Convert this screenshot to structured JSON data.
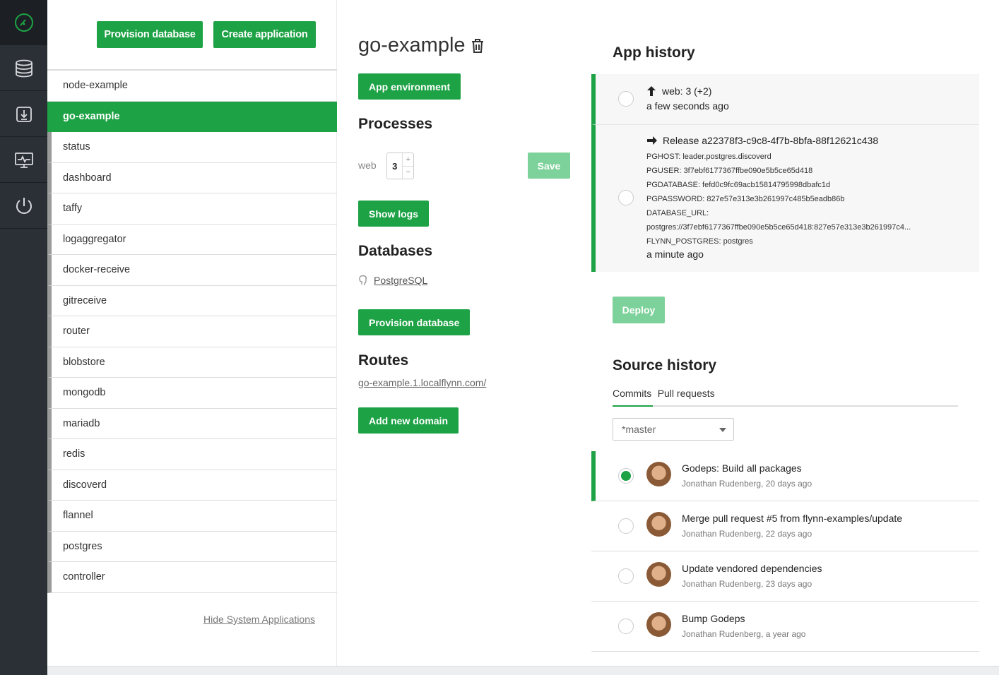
{
  "rail": {
    "items": [
      {
        "icon": "dashboard-gauge-icon",
        "active": true
      },
      {
        "icon": "database-icon",
        "active": false
      },
      {
        "icon": "download-icon",
        "active": false
      },
      {
        "icon": "monitor-icon",
        "active": false
      },
      {
        "icon": "power-icon",
        "active": false
      }
    ]
  },
  "apps": {
    "provision_db_label": "Provision database",
    "create_app_label": "Create application",
    "items": [
      {
        "name": "node-example",
        "system": false,
        "active": false
      },
      {
        "name": "go-example",
        "system": false,
        "active": true
      },
      {
        "name": "status",
        "system": true
      },
      {
        "name": "dashboard",
        "system": true
      },
      {
        "name": "taffy",
        "system": true
      },
      {
        "name": "logaggregator",
        "system": true
      },
      {
        "name": "docker-receive",
        "system": true
      },
      {
        "name": "gitreceive",
        "system": true
      },
      {
        "name": "router",
        "system": true
      },
      {
        "name": "blobstore",
        "system": true
      },
      {
        "name": "mongodb",
        "system": true
      },
      {
        "name": "mariadb",
        "system": true
      },
      {
        "name": "redis",
        "system": true
      },
      {
        "name": "discoverd",
        "system": true
      },
      {
        "name": "flannel",
        "system": true
      },
      {
        "name": "postgres",
        "system": true
      },
      {
        "name": "controller",
        "system": true
      }
    ],
    "hide_system_label": "Hide System Applications"
  },
  "detail": {
    "title": "go-example",
    "app_env_label": "App environment",
    "processes_heading": "Processes",
    "process_type": "web",
    "process_count": "3",
    "save_label": "Save",
    "show_logs_label": "Show logs",
    "databases_heading": "Databases",
    "db_link": "PostgreSQL",
    "provision_db_label": "Provision database",
    "routes_heading": "Routes",
    "route_link": "go-example.1.localflynn.com/",
    "add_domain_label": "Add new domain"
  },
  "history": {
    "heading": "App history",
    "events": [
      {
        "title": "web: 3 (+2)",
        "ago": "a few seconds ago"
      },
      {
        "title": "Release a22378f3-c9c8-4f7b-8bfa-88f12621c438",
        "env": [
          "PGHOST: leader.postgres.discoverd",
          "PGUSER: 3f7ebf6177367ffbe090e5b5ce65d418",
          "PGDATABASE: fefd0c9fc69acb15814795998dbafc1d",
          "PGPASSWORD: 827e57e313e3b261997c485b5eadb86b",
          "DATABASE_URL:",
          "postgres://3f7ebf6177367ffbe090e5b5ce65d418:827e57e313e3b261997c4...",
          "FLYNN_POSTGRES: postgres"
        ],
        "ago": "a minute ago"
      }
    ],
    "deploy_label": "Deploy"
  },
  "source": {
    "heading": "Source history",
    "tabs": [
      "Commits",
      "Pull requests"
    ],
    "branch": "*master",
    "commits": [
      {
        "message": "Godeps: Build all packages",
        "meta": "Jonathan Rudenberg, 20 days ago",
        "selected": true
      },
      {
        "message": "Merge pull request #5 from flynn-examples/update",
        "meta": "Jonathan Rudenberg, 22 days ago",
        "selected": false
      },
      {
        "message": "Update vendored dependencies",
        "meta": "Jonathan Rudenberg, 23 days ago",
        "selected": false
      },
      {
        "message": "Bump Godeps",
        "meta": "Jonathan Rudenberg, a year ago",
        "selected": false
      }
    ]
  },
  "colors": {
    "accent": "#1da245",
    "rail": "#2b2f36",
    "system_marker": "#9a9a9a"
  }
}
